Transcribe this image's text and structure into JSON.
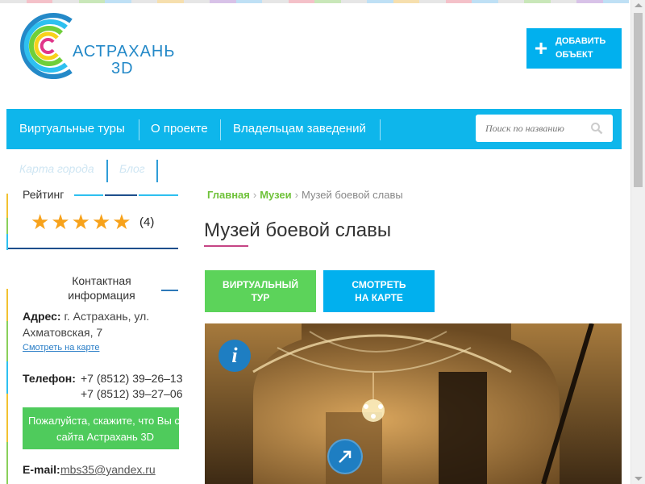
{
  "logo": {
    "line1": "АСТРАХАНЬ",
    "line2": "3D"
  },
  "header": {
    "add_button_line1": "ДОБАВИТЬ",
    "add_button_line2": "ОБЪЕКТ"
  },
  "nav": {
    "items": [
      "Виртуальные туры",
      "О проекте",
      "Владельцам заведений"
    ],
    "search_placeholder": "Поиск по названию"
  },
  "subnav": [
    "Карта города",
    "Блог"
  ],
  "sidebar": {
    "rating_title": "Рейтинг",
    "rating_value": 5,
    "rating_count": "(4)",
    "contact_title": "Контактная информация",
    "address_label": "Адрес:",
    "address_value": "г. Астрахань, ул. Ахматовская, 7",
    "map_link": "Смотреть на карте",
    "phone_label": "Телефон:",
    "phones": [
      "+7 (8512) 39–26–13",
      "+7 (8512) 39–27–06"
    ],
    "notice_line1": "Пожалуйста, скажите, что Вы с",
    "notice_line2": "сайта Астрахань 3D",
    "email_label": "E-mail:",
    "email_value": "mbs35@yandex.ru"
  },
  "breadcrumb": {
    "home": "Главная",
    "section": "Музеи",
    "current": "Музей боевой славы"
  },
  "page_title": "Музей боевой славы",
  "buttons": {
    "tour_line1": "ВИРТУАЛЬНЫЙ",
    "tour_line2": "ТУР",
    "map_line1": "СМОТРЕТЬ",
    "map_line2": "НА КАРТЕ"
  },
  "colors": {
    "accent_blue": "#0eb6eb",
    "button_green": "#5cd35a",
    "link_green": "#6fc23a",
    "star": "#f7a21b",
    "icon_blue": "#1e7ec2"
  },
  "icons": [
    "logo-rings-icon",
    "plus-icon",
    "search-icon",
    "star-icon",
    "info-icon",
    "expand-arrow-icon"
  ]
}
